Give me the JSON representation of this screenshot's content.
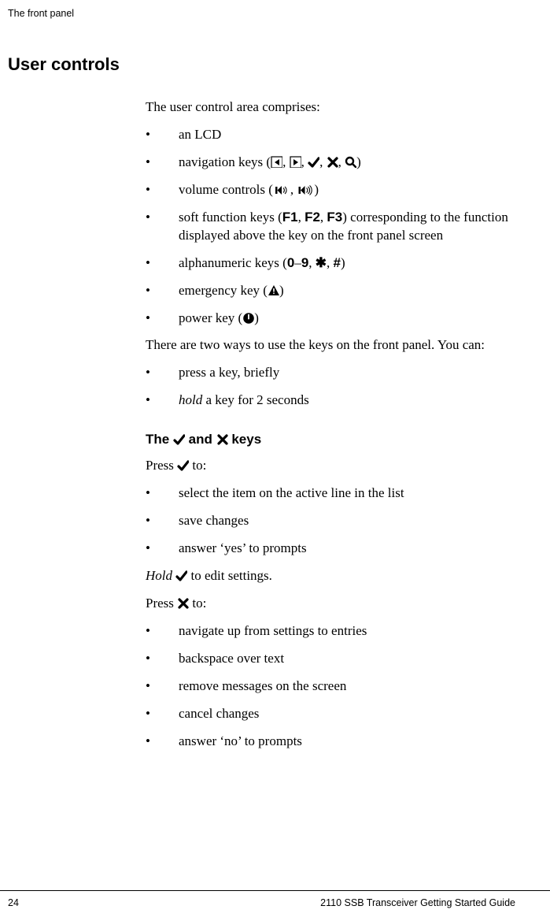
{
  "running_header": "The front panel",
  "section_title": "User controls",
  "intro_para": "The user control area comprises:",
  "list1": {
    "item1": "an LCD",
    "item2_a": "navigation keys (",
    "item2_b": ")",
    "item3_a": "volume controls (",
    "item3_b": ")",
    "item4_a": "soft function keys (",
    "item4_f1": "F1",
    "item4_f2": "F2",
    "item4_f3": "F3",
    "item4_b": ") corresponding to the function displayed above the key on the front panel screen",
    "item5_a": "alphanumeric keys (",
    "item5_k0": "0",
    "item5_dash": "–",
    "item5_k9": "9",
    "item5_star": "✱",
    "item5_hash": "#",
    "item5_b": ")",
    "item6_a": "emergency key (",
    "item6_b": ")",
    "item7_a": "power key (",
    "item7_b": ")"
  },
  "para2": "There are two ways to use the keys on the front panel. You can:",
  "list2": {
    "item1": "press a key, briefly",
    "item2_a": "hold",
    "item2_b": " a key for 2 seconds"
  },
  "sub_title_a": "The ",
  "sub_title_b": " and ",
  "sub_title_c": " keys",
  "press_tick_a": "Press ",
  "press_tick_b": " to:",
  "list3": {
    "item1": "select the item on the active line in the list",
    "item2": "save changes",
    "item3": "answer ‘yes’ to prompts"
  },
  "hold_tick_a": "Hold",
  "hold_tick_b": " to edit settings.",
  "press_x_a": "Press ",
  "press_x_b": " to:",
  "list4": {
    "item1": "navigate up from settings to entries",
    "item2": "backspace over text",
    "item3": "remove messages on the screen",
    "item4": "cancel changes",
    "item5": "answer ‘no’ to prompts"
  },
  "footer_page": "24",
  "footer_title": "2110 SSB Transceiver Getting Started Guide"
}
